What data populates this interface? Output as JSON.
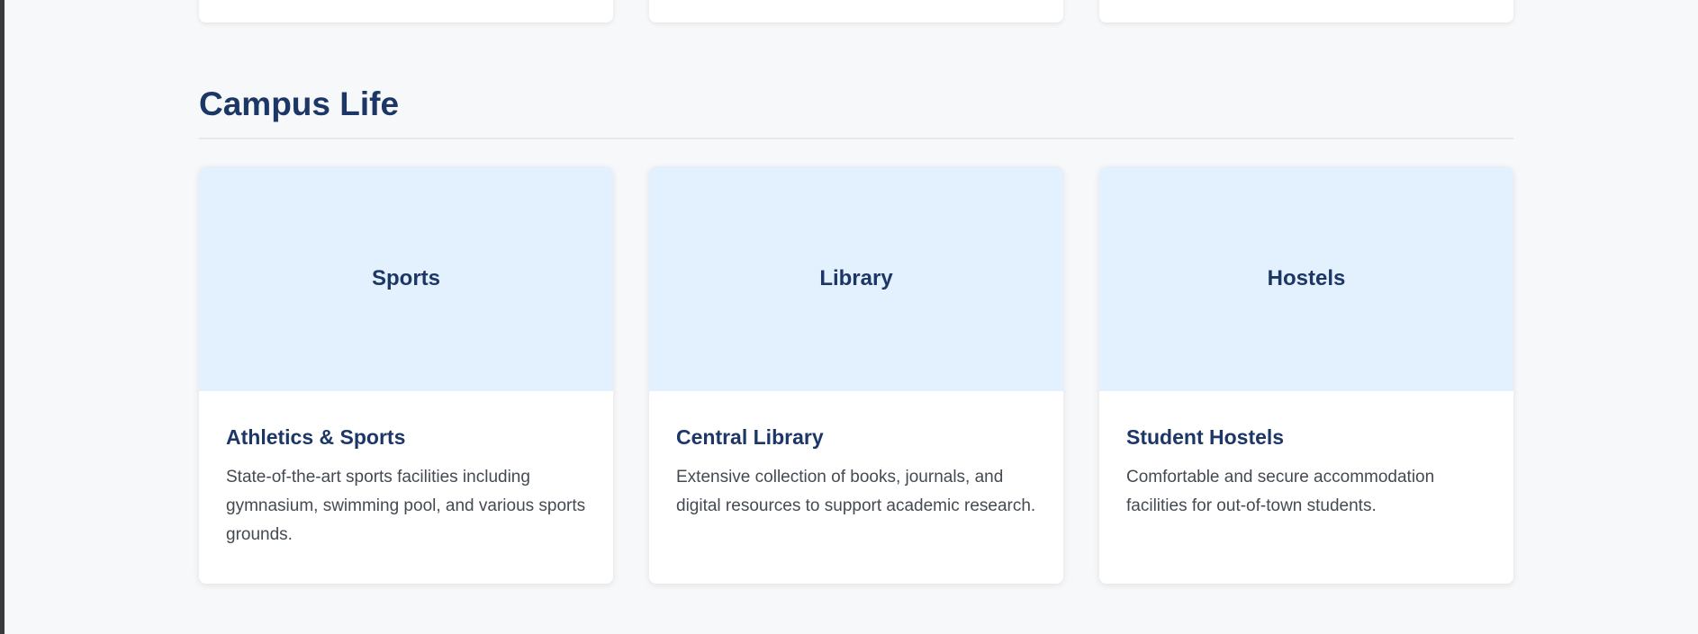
{
  "section": {
    "title": "Campus Life"
  },
  "cards": [
    {
      "banner_label": "Sports",
      "title": "Athletics & Sports",
      "description": "State-of-the-art sports facilities including gymnasium, swimming pool, and various sports grounds."
    },
    {
      "banner_label": "Library",
      "title": "Central Library",
      "description": "Extensive collection of books, journals, and digital resources to support academic research."
    },
    {
      "banner_label": "Hostels",
      "title": "Student Hostels",
      "description": "Comfortable and secure accommodation facilities for out-of-town students."
    }
  ],
  "colors": {
    "heading": "#1c3766",
    "banner_bg": "#e3f0fd",
    "page_bg": "#f7f8fa",
    "body_text": "#444a52"
  }
}
